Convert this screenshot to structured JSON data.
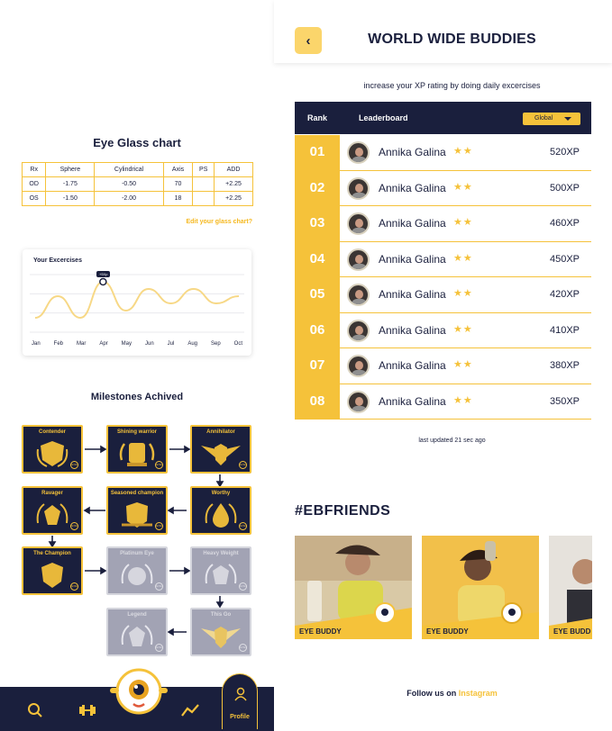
{
  "eye_glass": {
    "title": "Eye Glass chart",
    "headers": [
      "Rx",
      "Sphere",
      "Cylindrical",
      "Axis",
      "PS",
      "ADD"
    ],
    "rows": [
      [
        "OD",
        "-1.75",
        "-0.50",
        "70",
        "",
        "+2.25"
      ],
      [
        "OS",
        "-1.50",
        "-2.00",
        "18",
        "",
        "+2.25"
      ]
    ],
    "edit_link": "Edit your glass chart?"
  },
  "exercises": {
    "title": "Your Excercises",
    "tooltip": "+5Xp",
    "chart_data": {
      "type": "line",
      "title": "Your Excercises",
      "categories": [
        "Jan",
        "Feb",
        "Mar",
        "Apr",
        "May",
        "Jun",
        "Jul",
        "Aug",
        "Sep",
        "Oct"
      ],
      "series": [
        {
          "values": [
            2,
            5,
            2,
            7,
            3,
            6,
            4,
            6,
            4,
            5
          ]
        }
      ],
      "highlighted_point": "Apr",
      "grid": "horizontal",
      "color": "#f7d886"
    }
  },
  "milestones": {
    "title": "Milestones Achived",
    "badges": [
      {
        "name": "Contender",
        "locked": false
      },
      {
        "name": "Shining warrior",
        "locked": false
      },
      {
        "name": "Annihilator",
        "locked": false
      },
      {
        "name": "Ravager",
        "locked": false
      },
      {
        "name": "Seasoned champion",
        "locked": false
      },
      {
        "name": "Worthy",
        "locked": false
      },
      {
        "name": "The Champion",
        "locked": false
      },
      {
        "name": "Platinum Eye",
        "locked": true
      },
      {
        "name": "Heavy Weight",
        "locked": true
      },
      {
        "name": "Legend",
        "locked": true
      },
      {
        "name": "This Go",
        "locked": true
      }
    ],
    "badge_mark": "EYE"
  },
  "nav": {
    "items": [
      "search-icon",
      "dumbbell-icon",
      "mascot",
      "stats-icon",
      "profile-icon"
    ],
    "profile_label": "Profile"
  },
  "leaderboard": {
    "title": "WORLD WIDE BUDDIES",
    "subtitle": "increase your XP rating by doing daily excercises",
    "col_rank": "Rank",
    "col_board": "Leaderboard",
    "filter": "Global",
    "rows": [
      {
        "rank": "01",
        "name": "Annika Galina",
        "stars": "★★",
        "xp": "520XP"
      },
      {
        "rank": "02",
        "name": "Annika Galina",
        "stars": "★★",
        "xp": "500XP"
      },
      {
        "rank": "03",
        "name": "Annika Galina",
        "stars": "★★",
        "xp": "460XP"
      },
      {
        "rank": "04",
        "name": "Annika Galina",
        "stars": "★★",
        "xp": "450XP"
      },
      {
        "rank": "05",
        "name": "Annika Galina",
        "stars": "★★",
        "xp": "420XP"
      },
      {
        "rank": "06",
        "name": "Annika Galina",
        "stars": "★★",
        "xp": "410XP"
      },
      {
        "rank": "07",
        "name": "Annika Galina",
        "stars": "★★",
        "xp": "380XP"
      },
      {
        "rank": "08",
        "name": "Annika Galina",
        "stars": "★★",
        "xp": "350XP"
      }
    ],
    "updated": "last updated 21 sec ago"
  },
  "friends": {
    "title": "#EBFRIENDS",
    "posts": [
      {
        "label": "EYE BUDDY"
      },
      {
        "label": "EYE BUDDY"
      },
      {
        "label": "EYE BUDD"
      }
    ],
    "follow_prefix": "Follow us on",
    "follow_link": "Instagram"
  },
  "colors": {
    "navy": "#1a1f3d",
    "yellow": "#f5c23a",
    "locked": "#a2a3b4"
  }
}
